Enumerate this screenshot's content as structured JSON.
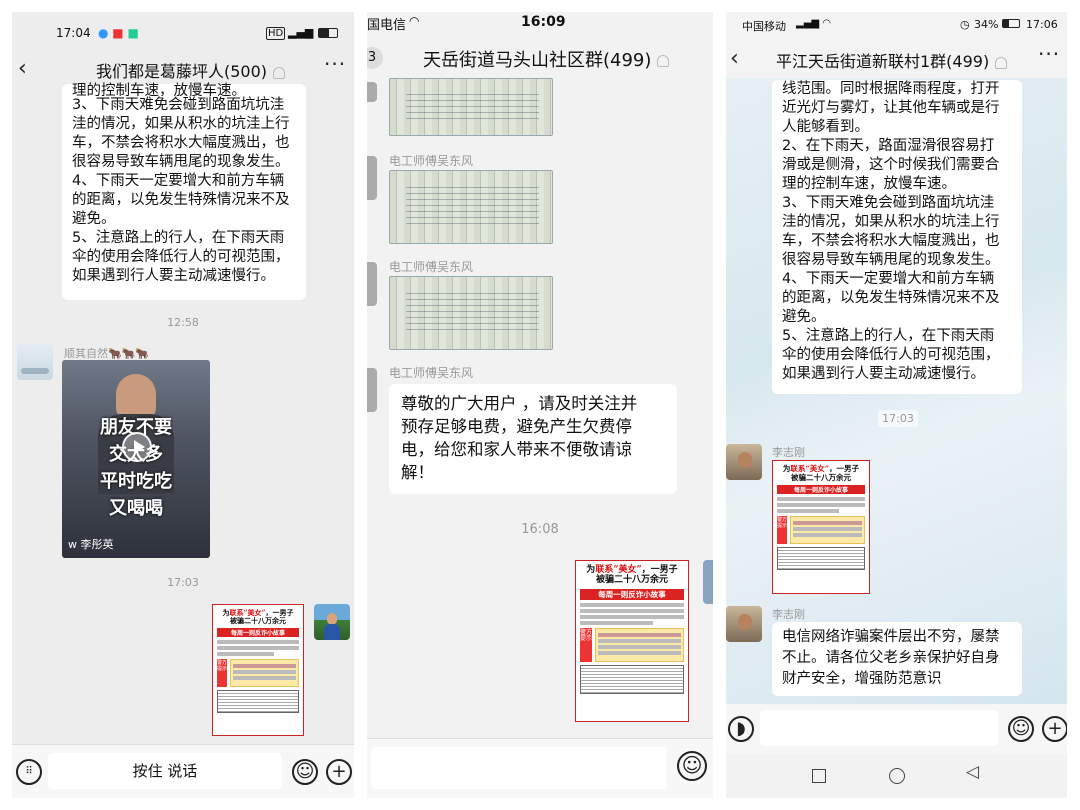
{
  "panel1": {
    "status_time": "17:04",
    "status_right": "HD",
    "title": "我们都是葛藤坪人(500)",
    "top_fragment": "理的控制车速，放慢车速。",
    "bubble_lines": [
      "3、下雨天难免会碰到路面坑坑洼",
      "洼的情况，如果从积水的坑洼上行",
      "车，不禁会将积水大幅度溅出，也",
      "很容易导致车辆甩尾的现象发生。",
      "4、下雨天一定要增大和前方车辆",
      "的距离，以免发生特殊情况来不及",
      "避免。",
      "5、注意路上的行人，在下雨天雨",
      "伞的使用会降低行人的可视范围，",
      "如果遇到行人要主动减速慢行。"
    ],
    "time_1": "12:58",
    "sender": "顺其自然🐂🐂🐂",
    "video_lines": [
      "朋友不要",
      "交太多",
      "平时吃吃",
      "又喝喝"
    ],
    "video_author": "李彤英",
    "time_2": "17:03",
    "input_label": "按住 说话"
  },
  "panel2": {
    "status_left": "国电信",
    "status_time": "16:09",
    "title": "天岳街道马头山社区群(499)",
    "badge": "3",
    "sender1": "电工师傅吴东风",
    "sender2": "电工师傅吴东风",
    "sender3": "电工师傅吴东风",
    "bubble_lines": [
      "尊敬的广大用户 ，请及时关注并",
      "预存足够电费，避免产生欠费停",
      "电，给您和家人带来不便敬请谅",
      "解！"
    ],
    "time_1": "16:08"
  },
  "panel3": {
    "status_left": "中国移动",
    "status_battery": "34%",
    "status_time": "17:06",
    "title": "平江天岳街道新联村1群(499)",
    "bubble_lines": [
      "线范围。同时根据降雨程度，打开",
      "近光灯与雾灯，让其他车辆或是行",
      "人能够看到。",
      "2、在下雨天，路面湿滑很容易打",
      "滑或是侧滑，这个时候我们需要合",
      "理的控制车速，放慢车速。",
      "3、下雨天难免会碰到路面坑坑洼",
      "洼的情况，如果从积水的坑洼上行",
      "车，不禁会将积水大幅度溅出，也",
      "很容易导致车辆甩尾的现象发生。",
      "4、下雨天一定要增大和前方车辆",
      "的距离，以免发生特殊情况来不及",
      "避免。",
      "5、注意路上的行人，在下雨天雨",
      "伞的使用会降低行人的可视范围，",
      "如果遇到行人要主动减速慢行。"
    ],
    "time_1": "17:03",
    "sender1": "李志刚",
    "sender2": "李志刚",
    "bubble2_lines": [
      "电信网络诈骗案件层出不穷，屡禁",
      "不止。请各位父老乡亲保护好自身",
      "财产安全，增强防范意识"
    ]
  },
  "poster": {
    "head_line1_a": "为",
    "head_line1_red": "联系“美女”",
    "head_line1_b": "，一男子",
    "head_line2": "被骗二十八万余元",
    "band": "每周一则反诈小故事",
    "side_label": "警方提示"
  },
  "colors": {
    "bubble": "#ffffff",
    "poster_red": "#d22222",
    "bg": "#ededed",
    "bg3": "#e3eef3"
  },
  "icons": [
    "back-icon",
    "more-icon",
    "mute-icon",
    "emoji-icon",
    "plus-icon",
    "keyboard-icon",
    "voice-icon",
    "play-icon",
    "wifi-icon",
    "battery-icon"
  ]
}
